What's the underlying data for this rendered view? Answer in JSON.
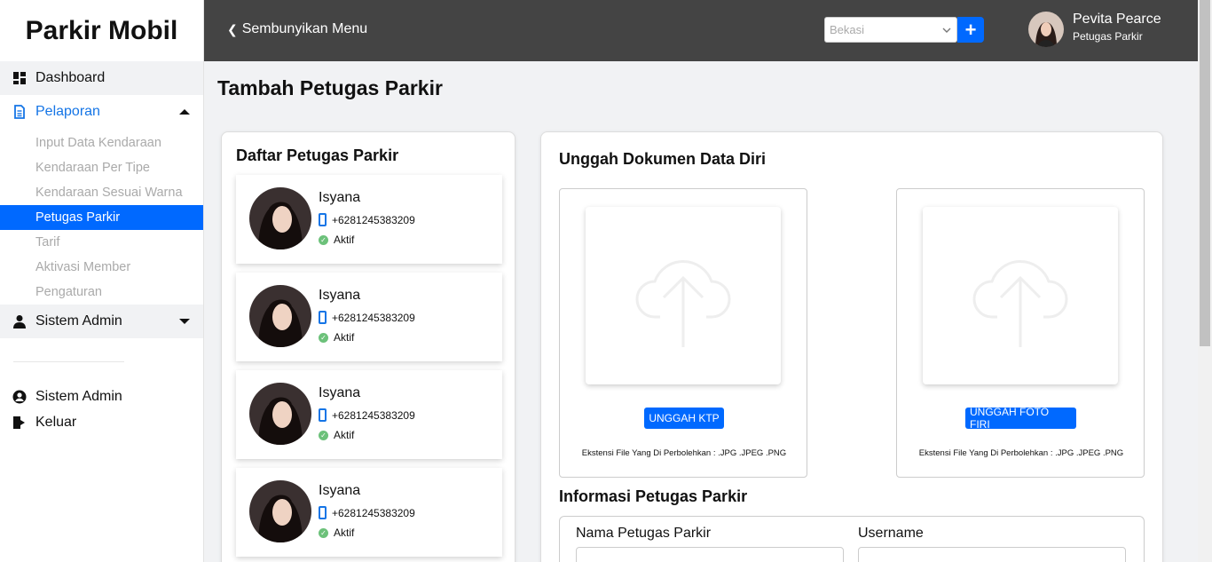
{
  "brand": "Parkir Mobil",
  "sidebar": {
    "dashboard": "Dashboard",
    "pelaporan": "Pelaporan",
    "sub_items": [
      "Input Data Kendaraan",
      "Kendaraan Per Tipe",
      "Kendaraan Sesuai Warna",
      "Petugas Parkir",
      "Tarif",
      "Aktivasi Member",
      "Pengaturan"
    ],
    "active_sub_item": "Petugas Parkir",
    "sistem_admin": "Sistem Admin",
    "bottom_items": [
      "Sistem Admin",
      "Keluar"
    ]
  },
  "header": {
    "hide_menu": "Sembunyikan Menu",
    "city_placeholder": "Bekasi",
    "add_label": "+",
    "user_name": "Pevita Pearce",
    "user_role": "Petugas Parkir"
  },
  "page_title": "Tambah Petugas Parkir",
  "staff_list": {
    "title": "Daftar Petugas Parkir",
    "items": [
      {
        "name": "Isyana",
        "phone": "+6281245383209",
        "status": "Aktif"
      },
      {
        "name": "Isyana",
        "phone": "+6281245383209",
        "status": "Aktif"
      },
      {
        "name": "Isyana",
        "phone": "+6281245383209",
        "status": "Aktif"
      },
      {
        "name": "Isyana",
        "phone": "+6281245383209",
        "status": "Aktif"
      }
    ]
  },
  "upload": {
    "title": "Unggah Dokumen Data Diri",
    "ktp_button": "UNGGAH KTP",
    "photo_button": "UNGGAH FOTO FIRI",
    "note": "Ekstensi File Yang Di Perbolehkan : .JPG .JPEG .PNG"
  },
  "info": {
    "title": "Informasi Petugas Parkir",
    "name_label": "Nama Petugas Parkir",
    "username_label": "Username"
  },
  "colors": {
    "accent": "#0069ff",
    "header_bg": "#444444",
    "status_ok": "#6cc17a"
  }
}
